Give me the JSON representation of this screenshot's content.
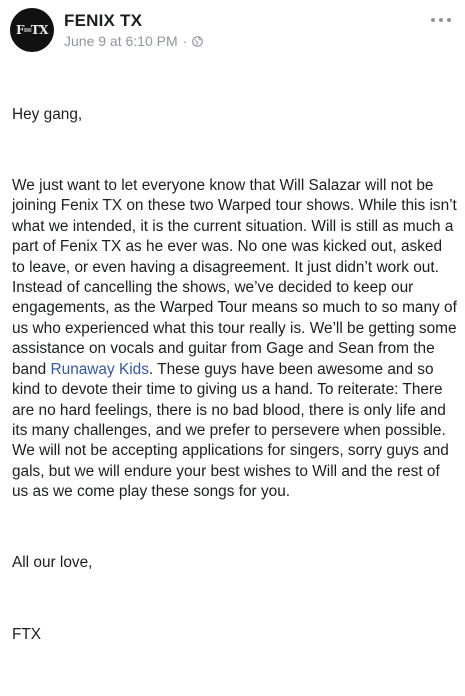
{
  "post": {
    "page_name": "FENIX TX",
    "avatar_text": "F═TX",
    "date": "June 9 at 6:10 PM",
    "separator": "·",
    "privacy_icon": "globe-icon",
    "more_icon": "more-options-icon",
    "greeting": "Hey gang,",
    "body_before_link": "We just want to let everyone know that Will Salazar will not be joining Fenix TX on these two Warped tour shows. While this isn’t what we intended, it is the current situation. Will is still as much a part of Fenix TX as he ever was. No one was kicked out, asked to leave, or even having a disagreement. It just didn’t work out. Instead of cancelling the shows, we’ve decided to keep our engagements, as the Warped Tour means so much to so many of us who experienced what this tour really is. We’ll be getting some assistance on vocals and guitar from Gage and Sean from the band ",
    "link_text": "Runaway Kids",
    "body_after_link": ". These guys have been awesome and so kind to devote their time to giving us a hand. To reiterate: There are no hard feelings, there is no bad blood, there is only life and its many challenges, and we prefer to persevere when possible. We will not be accepting applications for singers, sorry guys and gals, but we will endure your best wishes to Will and the rest of us as we come play these songs for you.",
    "signoff": "All our love,",
    "signature": "FTX"
  },
  "colors": {
    "text": "#1c1e21",
    "meta": "#90949c",
    "link": "#365899"
  }
}
